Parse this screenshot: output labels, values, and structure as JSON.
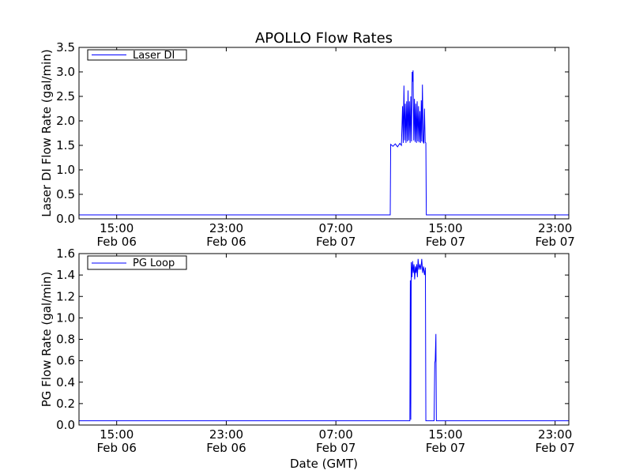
{
  "figure": {
    "title": "APOLLO Flow Rates",
    "xlabel": "Date (GMT)"
  },
  "chart_data": [
    {
      "type": "line",
      "title": "APOLLO Flow Rates",
      "xlabel": "",
      "ylabel": "Laser DI Flow Rate (gal/min)",
      "xlim": [
        "2011-02-06T12:15",
        "2011-02-08T00:00"
      ],
      "ylim": [
        0,
        3.5
      ],
      "yticks": [
        0.0,
        0.5,
        1.0,
        1.5,
        2.0,
        2.5,
        3.0,
        3.5
      ],
      "ytick_labels": [
        "0.0",
        "0.5",
        "1.0",
        "1.5",
        "2.0",
        "2.5",
        "3.0",
        "3.5"
      ],
      "xticks": [
        {
          "time": "2011-02-06T15:00",
          "label_time": "15:00",
          "label_date": "Feb 06"
        },
        {
          "time": "2011-02-06T23:00",
          "label_time": "23:00",
          "label_date": "Feb 06"
        },
        {
          "time": "2011-02-07T07:00",
          "label_time": "07:00",
          "label_date": "Feb 07"
        },
        {
          "time": "2011-02-07T15:00",
          "label_time": "15:00",
          "label_date": "Feb 07"
        },
        {
          "time": "2011-02-07T23:00",
          "label_time": "23:00",
          "label_date": "Feb 07"
        }
      ],
      "legend": {
        "placement": "top-left"
      },
      "grid": false,
      "series": [
        {
          "name": "Laser DI",
          "color": "#0000ff",
          "points": [
            [
              "2011-02-06T12:15",
              0.08
            ],
            [
              "2011-02-07T10:58",
              0.08
            ],
            [
              "2011-02-07T11:00",
              1.52
            ],
            [
              "2011-02-07T11:10",
              1.48
            ],
            [
              "2011-02-07T11:20",
              1.53
            ],
            [
              "2011-02-07T11:30",
              1.47
            ],
            [
              "2011-02-07T11:40",
              1.54
            ],
            [
              "2011-02-07T11:47",
              1.5
            ],
            [
              "2011-02-07T11:52",
              2.3
            ],
            [
              "2011-02-07T11:55",
              1.55
            ],
            [
              "2011-02-07T11:58",
              2.72
            ],
            [
              "2011-02-07T12:01",
              1.6
            ],
            [
              "2011-02-07T12:04",
              2.35
            ],
            [
              "2011-02-07T12:07",
              1.55
            ],
            [
              "2011-02-07T12:10",
              2.4
            ],
            [
              "2011-02-07T12:13",
              1.58
            ],
            [
              "2011-02-07T12:16",
              2.62
            ],
            [
              "2011-02-07T12:19",
              1.6
            ],
            [
              "2011-02-07T12:22",
              2.4
            ],
            [
              "2011-02-07T12:25",
              1.55
            ],
            [
              "2011-02-07T12:28",
              2.5
            ],
            [
              "2011-02-07T12:31",
              1.58
            ],
            [
              "2011-02-07T12:34",
              3.0
            ],
            [
              "2011-02-07T12:36",
              2.8
            ],
            [
              "2011-02-07T12:38",
              3.03
            ],
            [
              "2011-02-07T12:41",
              1.6
            ],
            [
              "2011-02-07T12:44",
              2.45
            ],
            [
              "2011-02-07T12:47",
              1.57
            ],
            [
              "2011-02-07T12:50",
              2.35
            ],
            [
              "2011-02-07T12:53",
              1.55
            ],
            [
              "2011-02-07T12:56",
              2.4
            ],
            [
              "2011-02-07T12:59",
              1.58
            ],
            [
              "2011-02-07T13:02",
              2.3
            ],
            [
              "2011-02-07T13:05",
              1.56
            ],
            [
              "2011-02-07T13:08",
              2.2
            ],
            [
              "2011-02-07T13:11",
              1.55
            ],
            [
              "2011-02-07T13:14",
              2.42
            ],
            [
              "2011-02-07T13:16",
              1.58
            ],
            [
              "2011-02-07T13:19",
              2.74
            ],
            [
              "2011-02-07T13:22",
              1.57
            ],
            [
              "2011-02-07T13:25",
              1.55
            ],
            [
              "2011-02-07T13:28",
              2.25
            ],
            [
              "2011-02-07T13:31",
              1.56
            ],
            [
              "2011-02-07T13:34",
              1.55
            ],
            [
              "2011-02-07T13:36",
              0.08
            ],
            [
              "2011-02-08T00:00",
              0.08
            ]
          ]
        }
      ]
    },
    {
      "type": "line",
      "xlabel": "Date (GMT)",
      "ylabel": "PG Flow Rate (gal/min)",
      "xlim": [
        "2011-02-06T12:15",
        "2011-02-08T00:00"
      ],
      "ylim": [
        0,
        1.6
      ],
      "yticks": [
        0.0,
        0.2,
        0.4,
        0.6,
        0.8,
        1.0,
        1.2,
        1.4,
        1.6
      ],
      "ytick_labels": [
        "0.0",
        "0.2",
        "0.4",
        "0.6",
        "0.8",
        "1.0",
        "1.2",
        "1.4",
        "1.6"
      ],
      "xticks": [
        {
          "time": "2011-02-06T15:00",
          "label_time": "15:00",
          "label_date": "Feb 06"
        },
        {
          "time": "2011-02-06T23:00",
          "label_time": "23:00",
          "label_date": "Feb 06"
        },
        {
          "time": "2011-02-07T07:00",
          "label_time": "07:00",
          "label_date": "Feb 07"
        },
        {
          "time": "2011-02-07T15:00",
          "label_time": "15:00",
          "label_date": "Feb 07"
        },
        {
          "time": "2011-02-07T23:00",
          "label_time": "23:00",
          "label_date": "Feb 07"
        }
      ],
      "legend": {
        "placement": "top-left"
      },
      "grid": false,
      "series": [
        {
          "name": "PG Loop",
          "color": "#0000ff",
          "points": [
            [
              "2011-02-06T12:15",
              0.04
            ],
            [
              "2011-02-07T12:24",
              0.04
            ],
            [
              "2011-02-07T12:26",
              1.35
            ],
            [
              "2011-02-07T12:28",
              0.05
            ],
            [
              "2011-02-07T12:30",
              1.52
            ],
            [
              "2011-02-07T12:33",
              1.38
            ],
            [
              "2011-02-07T12:36",
              1.53
            ],
            [
              "2011-02-07T12:39",
              1.42
            ],
            [
              "2011-02-07T12:42",
              1.5
            ],
            [
              "2011-02-07T12:45",
              1.36
            ],
            [
              "2011-02-07T12:48",
              1.48
            ],
            [
              "2011-02-07T12:51",
              1.42
            ],
            [
              "2011-02-07T12:54",
              1.5
            ],
            [
              "2011-02-07T12:57",
              1.38
            ],
            [
              "2011-02-07T13:00",
              1.55
            ],
            [
              "2011-02-07T13:04",
              1.45
            ],
            [
              "2011-02-07T13:08",
              1.5
            ],
            [
              "2011-02-07T13:12",
              1.45
            ],
            [
              "2011-02-07T13:16",
              1.55
            ],
            [
              "2011-02-07T13:20",
              1.42
            ],
            [
              "2011-02-07T13:24",
              1.48
            ],
            [
              "2011-02-07T13:28",
              1.4
            ],
            [
              "2011-02-07T13:32",
              1.47
            ],
            [
              "2011-02-07T13:34",
              0.04
            ],
            [
              "2011-02-07T14:10",
              0.04
            ],
            [
              "2011-02-07T14:13",
              0.58
            ],
            [
              "2011-02-07T14:15",
              0.6
            ],
            [
              "2011-02-07T14:18",
              0.85
            ],
            [
              "2011-02-07T14:20",
              0.04
            ],
            [
              "2011-02-08T00:00",
              0.04
            ]
          ]
        }
      ]
    }
  ]
}
